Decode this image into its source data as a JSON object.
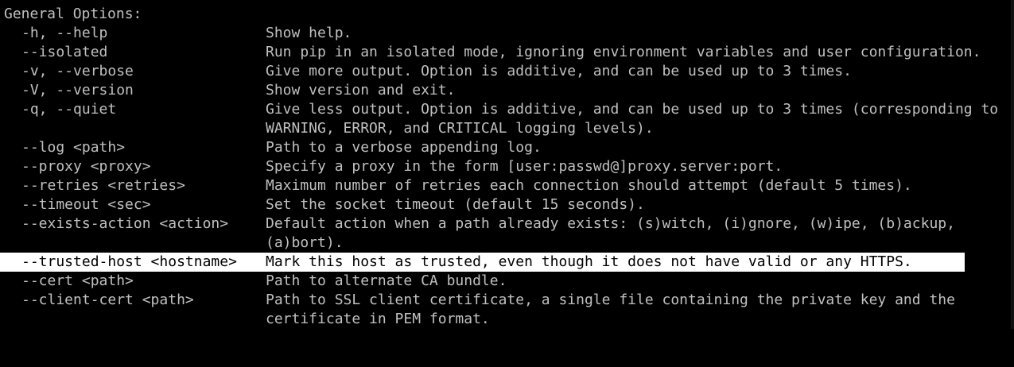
{
  "colors": {
    "background": "#000000",
    "text": "#c0c0c0",
    "highlight_bg": "#ffffff",
    "highlight_text": "#000000"
  },
  "heading": "General Options:",
  "options": [
    {
      "flag": "-h, --help",
      "lines": [
        "Show help."
      ]
    },
    {
      "flag": "--isolated",
      "lines": [
        "Run pip in an isolated mode, ignoring environment variables and user configuration."
      ]
    },
    {
      "flag": "-v, --verbose",
      "lines": [
        "Give more output. Option is additive, and can be used up to 3 times."
      ]
    },
    {
      "flag": "-V, --version",
      "lines": [
        "Show version and exit."
      ]
    },
    {
      "flag": "-q, --quiet",
      "lines": [
        "Give less output. Option is additive, and can be used up to 3 times (corresponding to",
        "WARNING, ERROR, and CRITICAL logging levels)."
      ]
    },
    {
      "flag": "--log <path>",
      "lines": [
        "Path to a verbose appending log."
      ]
    },
    {
      "flag": "--proxy <proxy>",
      "lines": [
        "Specify a proxy in the form [user:passwd@]proxy.server:port."
      ]
    },
    {
      "flag": "--retries <retries>",
      "lines": [
        "Maximum number of retries each connection should attempt (default 5 times)."
      ]
    },
    {
      "flag": "--timeout <sec>",
      "lines": [
        "Set the socket timeout (default 15 seconds)."
      ]
    },
    {
      "flag": "--exists-action <action>",
      "lines": [
        "Default action when a path already exists: (s)witch, (i)gnore, (w)ipe, (b)ackup,",
        "(a)bort)."
      ]
    },
    {
      "flag": "--trusted-host <hostname>",
      "lines": [
        "Mark this host as trusted, even though it does not have valid or any HTTPS."
      ],
      "highlighted": true
    },
    {
      "flag": "--cert <path>",
      "lines": [
        "Path to alternate CA bundle."
      ]
    },
    {
      "flag": "--client-cert <path>",
      "lines": [
        "Path to SSL client certificate, a single file containing the private key and the",
        "certificate in PEM format."
      ]
    }
  ]
}
